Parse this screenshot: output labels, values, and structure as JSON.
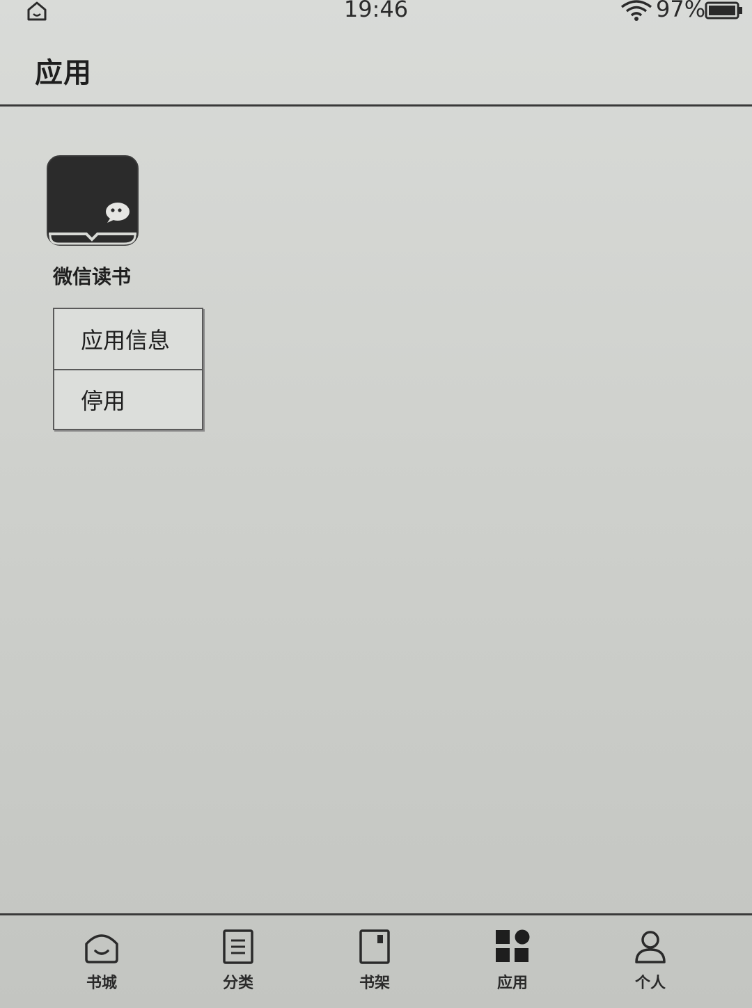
{
  "status_bar": {
    "time": "19:46",
    "battery": "97%",
    "icons": [
      "home-icon",
      "wifi-icon",
      "battery-icon"
    ]
  },
  "header": {
    "title": "应用"
  },
  "apps": [
    {
      "name": "微信读书",
      "icon": "weread-app-icon"
    }
  ],
  "context_menu": {
    "items": [
      {
        "label": "应用信息"
      },
      {
        "label": "停用"
      }
    ]
  },
  "bottom_nav": {
    "items": [
      {
        "label": "书城",
        "icon": "bookstore-icon",
        "active": false
      },
      {
        "label": "分类",
        "icon": "category-icon",
        "active": false
      },
      {
        "label": "书架",
        "icon": "bookshelf-icon",
        "active": false
      },
      {
        "label": "应用",
        "icon": "apps-icon",
        "active": true
      },
      {
        "label": "个人",
        "icon": "profile-icon",
        "active": false
      }
    ]
  }
}
